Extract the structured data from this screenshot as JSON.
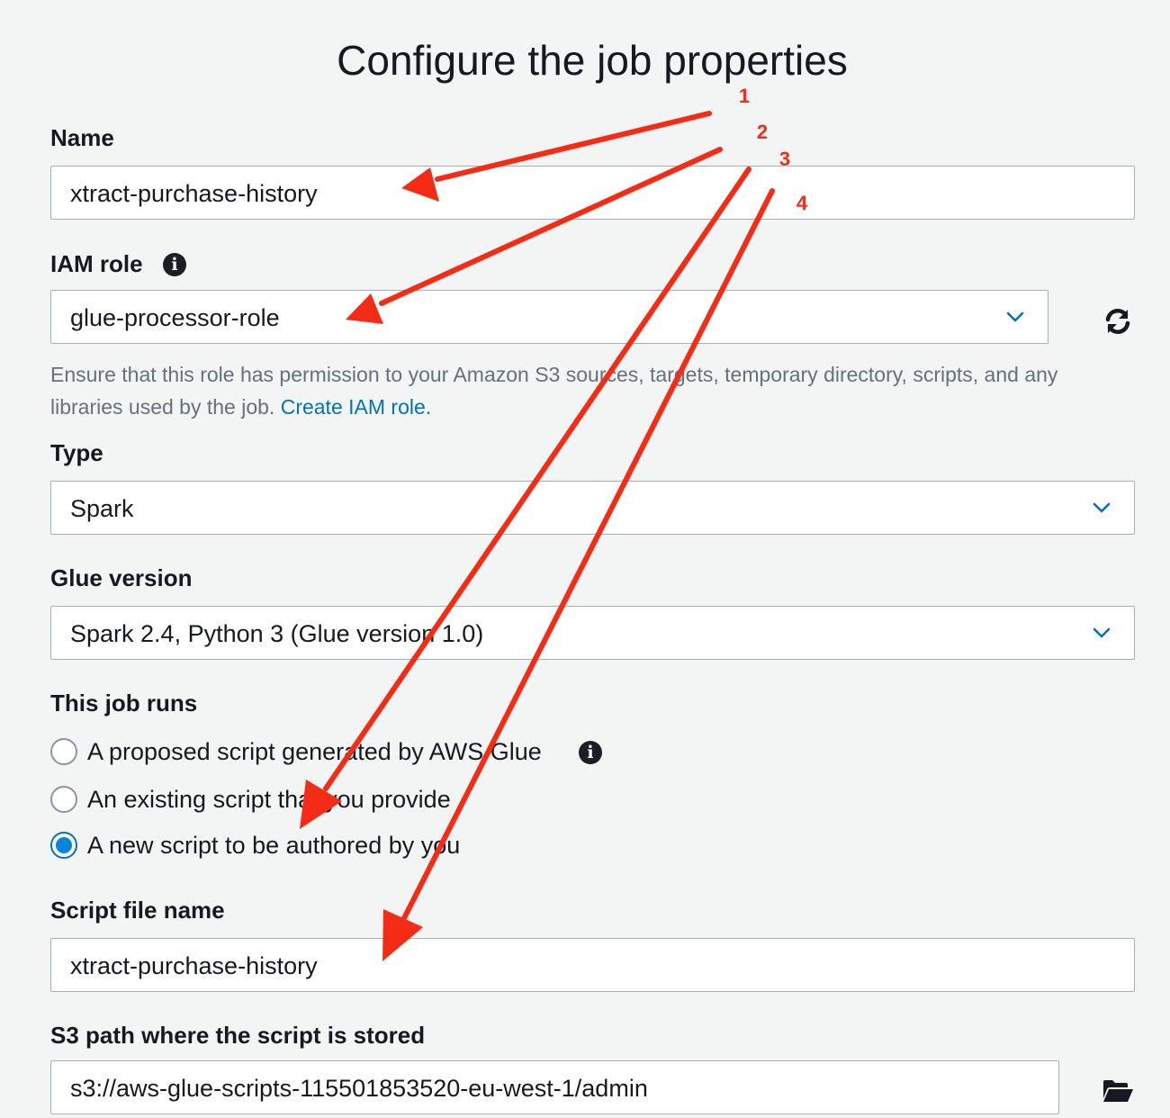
{
  "page": {
    "title": "Configure the job properties"
  },
  "name_field": {
    "label": "Name",
    "value": "xtract-purchase-history"
  },
  "iam_role": {
    "label": "IAM role",
    "value": "glue-processor-role",
    "help_text": "Ensure that this role has permission to your Amazon S3 sources, targets, temporary directory, scripts, and any libraries used by the job.",
    "help_link": "Create IAM role."
  },
  "type_field": {
    "label": "Type",
    "value": "Spark"
  },
  "glue_version": {
    "label": "Glue version",
    "value": "Spark 2.4, Python 3 (Glue version 1.0)"
  },
  "job_runs": {
    "label": "This job runs",
    "options": [
      "A proposed script generated by AWS Glue",
      "An existing script that you provide",
      "A new script to be authored by you"
    ],
    "selected": "A new script to be authored by you"
  },
  "script_file": {
    "label": "Script file name",
    "value": "xtract-purchase-history"
  },
  "s3_path": {
    "label": "S3 path where the script is stored",
    "value": "s3://aws-glue-scripts-115501853520-eu-west-1/admin"
  },
  "annotations": {
    "numbers": [
      "1",
      "2",
      "3",
      "4"
    ],
    "color": "#f42c15"
  },
  "icons": {
    "info": "info-icon",
    "refresh": "refresh-icon",
    "chevron": "chevron-down-icon",
    "folder": "folder-open-icon"
  },
  "colors": {
    "background": "#f3f4f4",
    "link": "#0073bb",
    "radio_selected": "#0a84d6",
    "chevron": "#0073bb"
  }
}
